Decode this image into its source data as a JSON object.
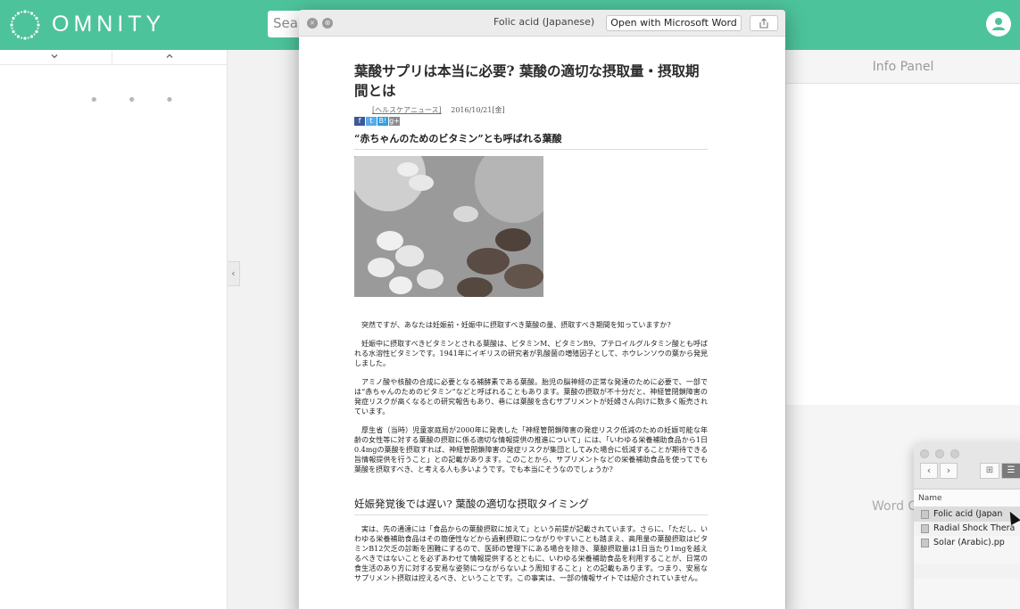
{
  "app": {
    "name": "OMNITY",
    "search_placeholder": "Sea",
    "user_icon": "user-icon"
  },
  "left_panel": {
    "expand_icon": "chevron-down-icon",
    "collapse_icon": "chevron-up-icon",
    "loading": "• • •",
    "collapse_tab_glyph": "‹"
  },
  "info_panel": {
    "title": "Info Panel",
    "word_label": "Word C"
  },
  "quicklook": {
    "title": "Folic acid (Japanese)",
    "open_button": "Open with Microsoft Word",
    "share_icon": "share-icon",
    "close_glyph": "×",
    "fullscreen_glyph": "⊗"
  },
  "document": {
    "title": "葉酸サプリは本当に必要?  葉酸の適切な摂取量・摂取期間とは",
    "source": "[ヘルスケアニュース]",
    "date": "2016/10/21[金]",
    "social": [
      "f",
      "t",
      "B!",
      "g+"
    ],
    "heading1": "“赤ちゃんのためのビタミン”とも呼ばれる葉酸",
    "paragraphs": [
      "突然ですが、あなたは妊娠前・妊娠中に摂取すべき葉酸の量、摂取すべき期間を知っていますか?",
      "妊娠中に摂取すべきビタミンとされる葉酸は、ビタミンM、ビタミンB9、プテロイルグルタミン酸とも呼ばれる水溶性ビタミンです。1941年にイギリスの研究者が乳酸菌の増殖因子として、ホウレンソウの葉から発見しました。",
      "アミノ酸や核酸の合成に必要となる補酵素である葉酸。胎児の脳神経の正常な発達のために必要で、一部では“赤ちゃんのためのビタミン”などと呼ばれることもあります。葉酸の摂取が不十分だと、神経管閉鎖障害の発症リスクが高くなるとの研究報告もあり、巷には葉酸を含むサプリメントが妊婦さん向けに数多く販売されています。",
      "厚生省（当時）児童家庭局が2000年に発表した「神経管閉鎖障害の発症リスク低減のための妊娠可能な年齢の女性等に対する葉酸の摂取に係る適切な情報提供の推進について」には、「いわゆる栄養補助食品から1日0.4mgの葉酸を摂取すれば、神経管閉鎖障害の発症リスクが集団としてみた場合に低減することが期待できる旨情報提供を行うこと」との記載があります。このことから、サプリメントなどの栄養補助食品を使ってでも葉酸を摂取すべき、と考える人も多いようです。でも本当にそうなのでしょうか?"
    ],
    "heading2": "妊娠発覚後では遅い?  葉酸の適切な摂取タイミング",
    "paragraph_last": "実は、先の通達には「食品からの葉酸摂取に加えて」という前提が記載されています。さらに、「ただし、いわゆる栄養補助食品はその簡便性などから過剰摂取につながりやすいことも踏まえ、高用量の葉酸摂取はビタミンB12欠乏の診断を困難にするので、医師の管理下にある場合を除き、葉酸摂取量は1日当たり1mgを越えるべきではないことを必ずあわせて情報提供するとともに、いわゆる栄養補助食品を利用することが、日常の食生活のあり方に対する安易な姿勢につながらないよう周知すること」との記載もあります。つまり、安易なサプリメント摂取は控えるべき、ということです。この事実は、一部の情報サイトでは紹介されていません。"
  },
  "finder": {
    "column_name": "Name",
    "back_glyph": "‹",
    "forward_glyph": "›",
    "view_icon_glyph": "⊞",
    "view_list_glyph": "☰",
    "files": [
      "Folic acid (Japan",
      "Radial Shock Thera",
      "Solar (Arabic).pp"
    ]
  },
  "colors": {
    "brand": "#4dc39b"
  }
}
